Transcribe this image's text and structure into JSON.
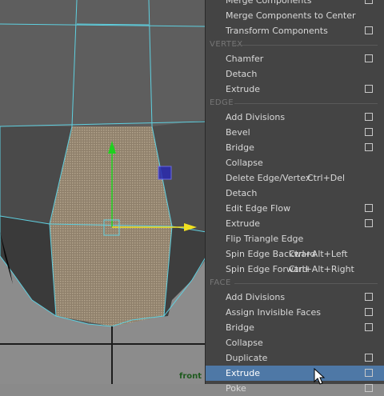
{
  "viewport": {
    "camera_label": "front"
  },
  "menu": {
    "groups": [
      {
        "section": "",
        "items": [
          {
            "label": "Merge Components",
            "shortcut": "",
            "option_box": true
          },
          {
            "label": "Merge Components to Center",
            "shortcut": "",
            "option_box": false
          },
          {
            "label": "Transform Components",
            "shortcut": "",
            "option_box": true
          }
        ]
      },
      {
        "section": "VERTEX",
        "items": [
          {
            "label": "Chamfer",
            "shortcut": "",
            "option_box": true
          },
          {
            "label": "Detach",
            "shortcut": "",
            "option_box": false
          },
          {
            "label": "Extrude",
            "shortcut": "",
            "option_box": true
          }
        ]
      },
      {
        "section": "EDGE",
        "items": [
          {
            "label": "Add Divisions",
            "shortcut": "",
            "option_box": true
          },
          {
            "label": "Bevel",
            "shortcut": "",
            "option_box": true
          },
          {
            "label": "Bridge",
            "shortcut": "",
            "option_box": true
          },
          {
            "label": "Collapse",
            "shortcut": "",
            "option_box": false
          },
          {
            "label": "Delete Edge/Vertex",
            "shortcut": "Ctrl+Del",
            "option_box": false
          },
          {
            "label": "Detach",
            "shortcut": "",
            "option_box": false
          },
          {
            "label": "Edit Edge Flow",
            "shortcut": "",
            "option_box": true
          },
          {
            "label": "Extrude",
            "shortcut": "",
            "option_box": true
          },
          {
            "label": "Flip Triangle Edge",
            "shortcut": "",
            "option_box": false
          },
          {
            "label": "Spin Edge Backward",
            "shortcut": "Ctrl+Alt+Left",
            "option_box": false
          },
          {
            "label": "Spin Edge Forward",
            "shortcut": "Ctrl+Alt+Right",
            "option_box": false
          }
        ]
      },
      {
        "section": "FACE",
        "items": [
          {
            "label": "Add Divisions",
            "shortcut": "",
            "option_box": true
          },
          {
            "label": "Assign Invisible Faces",
            "shortcut": "",
            "option_box": true
          },
          {
            "label": "Bridge",
            "shortcut": "",
            "option_box": true
          },
          {
            "label": "Collapse",
            "shortcut": "",
            "option_box": false
          },
          {
            "label": "Duplicate",
            "shortcut": "",
            "option_box": true
          },
          {
            "label": "Extrude",
            "shortcut": "",
            "option_box": true,
            "active": true
          },
          {
            "label": "Poke",
            "shortcut": "",
            "option_box": true
          }
        ]
      }
    ]
  },
  "colors": {
    "menu_bg": "#444444",
    "highlight": "#4e78a6",
    "wire": "#5fd0e0",
    "selected_face": "#9a8a72"
  }
}
